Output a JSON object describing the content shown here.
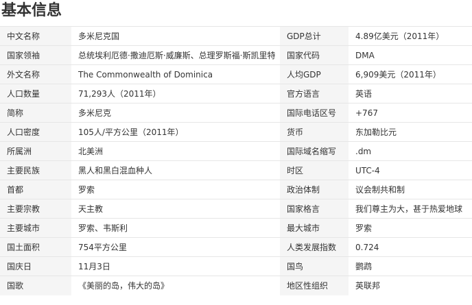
{
  "heading": "基本信息",
  "rows": [
    {
      "k1": "中文名称",
      "v1": "多米尼克国",
      "k2": "GDP总计",
      "v2": "4.89亿美元（2011年）"
    },
    {
      "k1": "国家领袖",
      "v1": "总统埃利厄德·撒迪厄斯·威廉斯、总理罗斯福·斯凯里特",
      "k2": "国家代码",
      "v2": "DMA"
    },
    {
      "k1": "外文名称",
      "v1": "The Commonwealth of Dominica",
      "k2": "人均GDP",
      "v2": "6,909美元（2011年）"
    },
    {
      "k1": "人口数量",
      "v1": "71,293人（2011年）",
      "k2": "官方语言",
      "v2": "英语"
    },
    {
      "k1": "简称",
      "v1": "多米尼克",
      "k2": "国际电话区号",
      "v2": "+767"
    },
    {
      "k1": "人口密度",
      "v1": "105人/平方公里（2011年）",
      "k2": "货币",
      "v2": "东加勒比元"
    },
    {
      "k1": "所属洲",
      "v1": "北美洲",
      "k2": "国际域名缩写",
      "v2": ".dm"
    },
    {
      "k1": "主要民族",
      "v1": "黑人和黑白混血种人",
      "k2": "时区",
      "v2": "UTC-4"
    },
    {
      "k1": "首都",
      "v1": "罗索",
      "k2": "政治体制",
      "v2": "议会制共和制"
    },
    {
      "k1": "主要宗教",
      "v1": "天主教",
      "k2": "国家格言",
      "v2": "我们尊主为大，甚于热爱地球"
    },
    {
      "k1": "主要城市",
      "v1": "罗索、韦斯利",
      "k2": "最大城市",
      "v2": "罗索"
    },
    {
      "k1": "国土面积",
      "v1": "754平方公里",
      "k2": "人类发展指数",
      "v2": "0.724"
    },
    {
      "k1": "国庆日",
      "v1": "11月3日",
      "k2": "国鸟",
      "v2": "鹦鹉"
    },
    {
      "k1": "国歌",
      "v1": "《美丽的岛，伟大的岛》",
      "k2": "地区性组织",
      "v2": "英联邦"
    }
  ]
}
